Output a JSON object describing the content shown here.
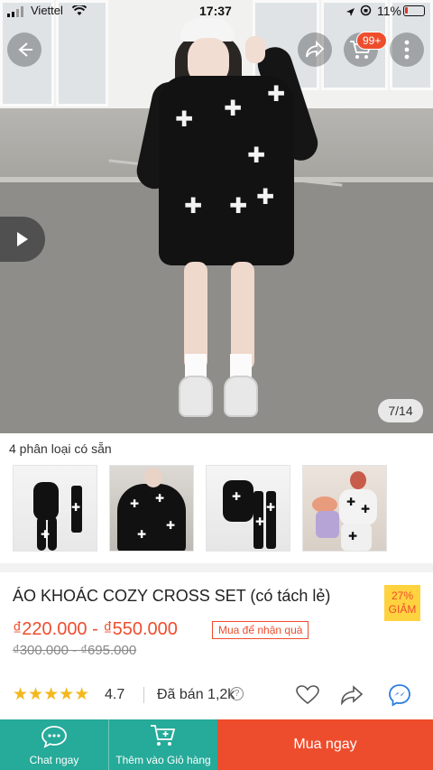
{
  "status_bar": {
    "carrier": "Viettel",
    "time": "17:37",
    "battery": "11%"
  },
  "header": {
    "cart_badge": "99+"
  },
  "gallery": {
    "page_indicator": "7/14"
  },
  "variations": {
    "label": "4 phân loại có sẵn",
    "count": 4
  },
  "product": {
    "title": "ÁO KHOÁC COZY CROSS SET (có tách lẻ)",
    "discount_line1": "27%",
    "discount_line2": "GIẢM",
    "price": "₫220.000 - ₫550.000",
    "promo": "Mua để nhận quà",
    "old_price": "₫300.000 - ₫695.000",
    "rating": "4.7",
    "rating_value": 4.7,
    "stars": "★★★★★",
    "sold": "Đã bán 1,2k"
  },
  "bottom_bar": {
    "chat_label": "Chat ngay",
    "cart_label": "Thêm vào Giỏ hàng",
    "buy_label": "Mua ngay"
  },
  "colors": {
    "accent": "#ee4d2d",
    "teal": "#26aa99",
    "star": "#f3b81c",
    "discount_bg": "#ffd23f"
  }
}
